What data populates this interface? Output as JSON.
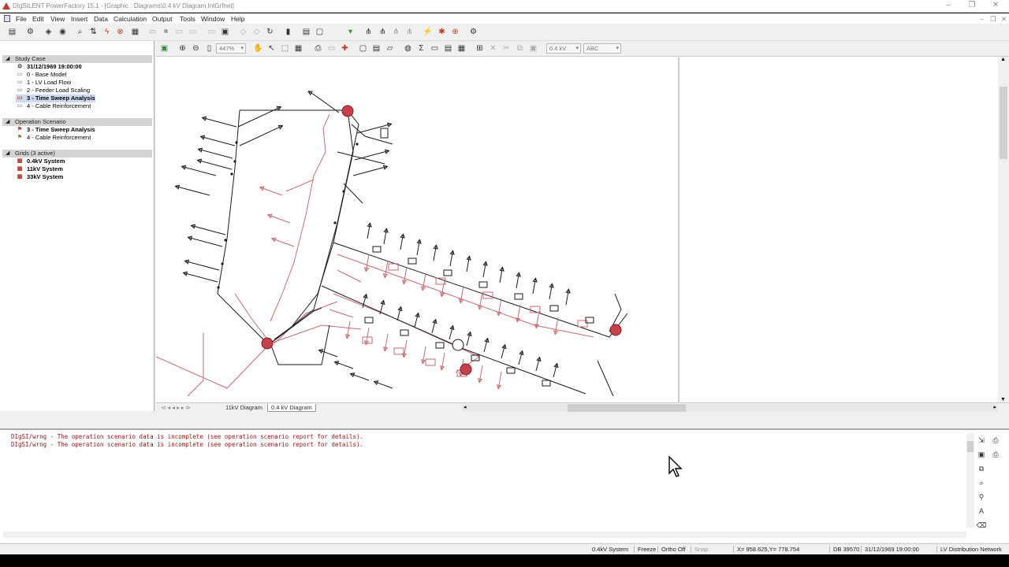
{
  "window": {
    "title": "DIgSILENT PowerFactory 15.1 - [Graphic : Diagrams\\0.4 kV Diagram.IntGrfnet]",
    "minimize_glyph": "–",
    "restore_glyph": "❐",
    "close_glyph": "✕"
  },
  "menu": [
    "File",
    "Edit",
    "View",
    "Insert",
    "Data",
    "Calculation",
    "Output",
    "Tools",
    "Window",
    "Help"
  ],
  "tree": {
    "study_case_header": "Study Case",
    "study_case_time": "31/12/1969 19:00:00",
    "study_cases": [
      "0 - Base Model",
      "1 - LV Load Flow",
      "2 - Feeder Load Scaling",
      "3 - Time Sweep Analysis",
      "4 - Cable Reinforcement"
    ],
    "scenario_header": "Operation Scenario",
    "scenarios": [
      "3 - Time Sweep Analysis",
      "4 - Cable Reinforcement"
    ],
    "grids_header": "Grids (3 active)",
    "grids": [
      "0.4kV System",
      "11kV System",
      "33kV System"
    ]
  },
  "graphic_toolbar": {
    "zoom_value": "447%",
    "voltage_value": "0.4 kV",
    "phase_value": "ABC"
  },
  "tabs": [
    "11kV Diagram",
    "0.4 kV Diagram"
  ],
  "output": {
    "lines": [
      "DIgSI/wrng - The operation scenario data is incomplete (see operation scenario report for details).",
      "DIgSI/wrng - The operation scenario data is incomplete (see operation scenario report for details)."
    ]
  },
  "status": {
    "grid": "0.4kV System",
    "freeze": "Freeze",
    "ortho": "Ortho Off",
    "snap": "Snap",
    "coords": "X=   958.625,Y=   778.754",
    "db": "DB 39570",
    "datetime": "31/12/1969 19:00:00",
    "project": "LV Distribution Network"
  },
  "colors": {
    "busbar_red": "#c8404a",
    "line_black": "#1a1a1a",
    "line_red": "#c86b72",
    "selection": "#cdd9ee"
  }
}
